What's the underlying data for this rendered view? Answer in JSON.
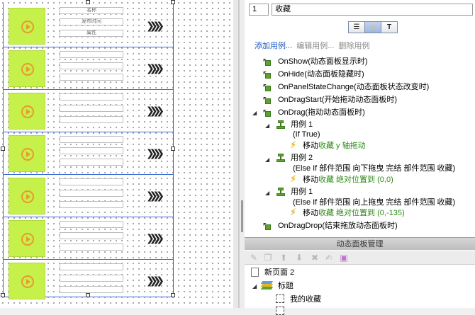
{
  "canvas": {
    "row_labels": [
      "名称",
      "发布时间",
      "属性"
    ]
  },
  "properties": {
    "id_value": "1",
    "name_value": "收藏",
    "tabs": [
      {
        "name": "notes-tab",
        "icon": "note-icon"
      },
      {
        "name": "interactions-tab",
        "icon": "lightning-icon"
      },
      {
        "name": "style-tab",
        "icon": "text-style-icon"
      }
    ],
    "actions": {
      "add": "添加用例...",
      "edit": "编辑用例...",
      "delete": "删除用例"
    },
    "events": [
      {
        "label": "OnShow(动态面板显示时)"
      },
      {
        "label": "OnHide(动态面板隐藏时)"
      },
      {
        "label": "OnPanelStateChange(动态面板状态改变时)"
      },
      {
        "label": "OnDragStart(开始拖动动态面板时)"
      },
      {
        "label": "OnDrag(拖动动态面板时)"
      }
    ],
    "cases": [
      {
        "title": "用例 1",
        "condition": "(If True)",
        "action_prefix": "移动",
        "action_detail": "收藏 y 轴拖动"
      },
      {
        "title": "用例 2",
        "condition": "(Else If 部件范围 向下拖曳 完结 部件范围 收藏)",
        "action_prefix": "移动",
        "action_detail": "收藏 绝对位置到 (0,0)"
      },
      {
        "title": "用例 1",
        "condition": "(Else If 部件范围 向上拖曳 完结 部件范围 收藏)",
        "action_prefix": "移动",
        "action_detail": "收藏 绝对位置到 (0,-135)"
      }
    ],
    "last_event": "OnDragDrop(结束拖放动态面板时)"
  },
  "manager": {
    "title": "动态面板管理",
    "page": "新页面 2",
    "panel": "标题",
    "state1": "我的收藏"
  },
  "colors": {
    "link": "#1a55c0",
    "action_green": "#2e8b1a",
    "thumb_fill": "#c6f04a",
    "selection_blue": "#3b6bd6"
  }
}
